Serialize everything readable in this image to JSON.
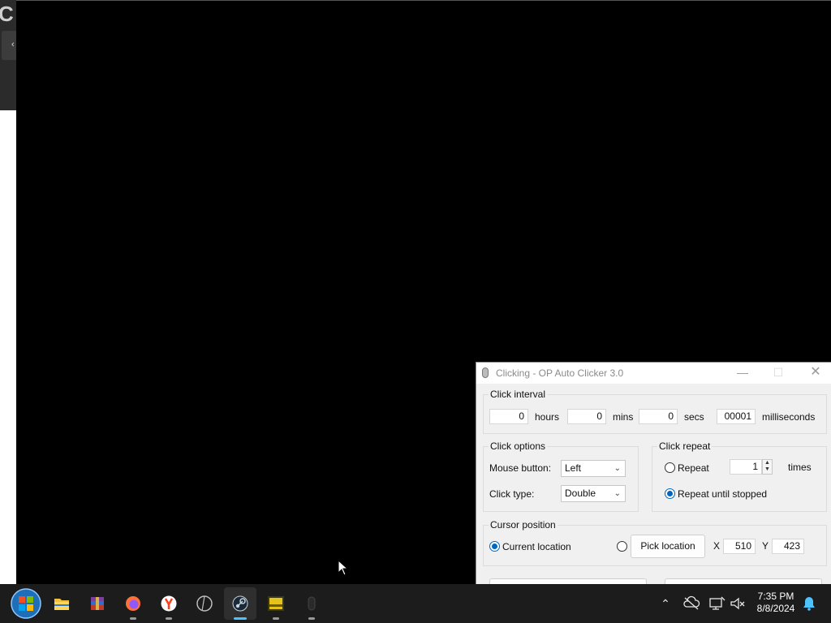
{
  "window": {
    "title": "Clicking - OP Auto Clicker 3.0",
    "minimize_glyph": "—",
    "maximize_glyph": "☐",
    "close_glyph": "✕"
  },
  "click_interval": {
    "legend": "Click interval",
    "hours_value": "0",
    "hours_label": "hours",
    "mins_value": "0",
    "mins_label": "mins",
    "secs_value": "0",
    "secs_label": "secs",
    "ms_value": "00001",
    "ms_label": "milliseconds"
  },
  "click_options": {
    "legend": "Click options",
    "mouse_button_label": "Mouse button:",
    "mouse_button_value": "Left",
    "click_type_label": "Click type:",
    "click_type_value": "Double"
  },
  "click_repeat": {
    "legend": "Click repeat",
    "repeat_label": "Repeat",
    "repeat_count": "1",
    "times_label": "times",
    "until_stopped_label": "Repeat until stopped",
    "selected": "until_stopped"
  },
  "cursor_position": {
    "legend": "Cursor position",
    "current_location_label": "Current location",
    "pick_location_label": "Pick location",
    "x_label": "X",
    "x_value": "510",
    "y_label": "Y",
    "y_value": "423",
    "selected": "current_location"
  },
  "taskbar": {
    "apps": [
      {
        "name": "start",
        "icon": "windows-orb-icon"
      },
      {
        "name": "file-explorer",
        "icon": "folder-icon"
      },
      {
        "name": "winrar",
        "icon": "winrar-icon"
      },
      {
        "name": "firefox",
        "icon": "firefox-icon"
      },
      {
        "name": "yandex-browser",
        "icon": "yandex-icon"
      },
      {
        "name": "app-circle",
        "icon": "circle-app-icon"
      },
      {
        "name": "steam",
        "icon": "steam-icon"
      },
      {
        "name": "game",
        "icon": "game-app-icon"
      },
      {
        "name": "auto-clicker",
        "icon": "mouse-icon"
      }
    ],
    "clock_time": "7:35 PM",
    "clock_date": "8/8/2024"
  },
  "colors": {
    "accent": "#0067c0",
    "taskbar": "#1c1c1c",
    "active_indicator": "#4cc2ff"
  }
}
